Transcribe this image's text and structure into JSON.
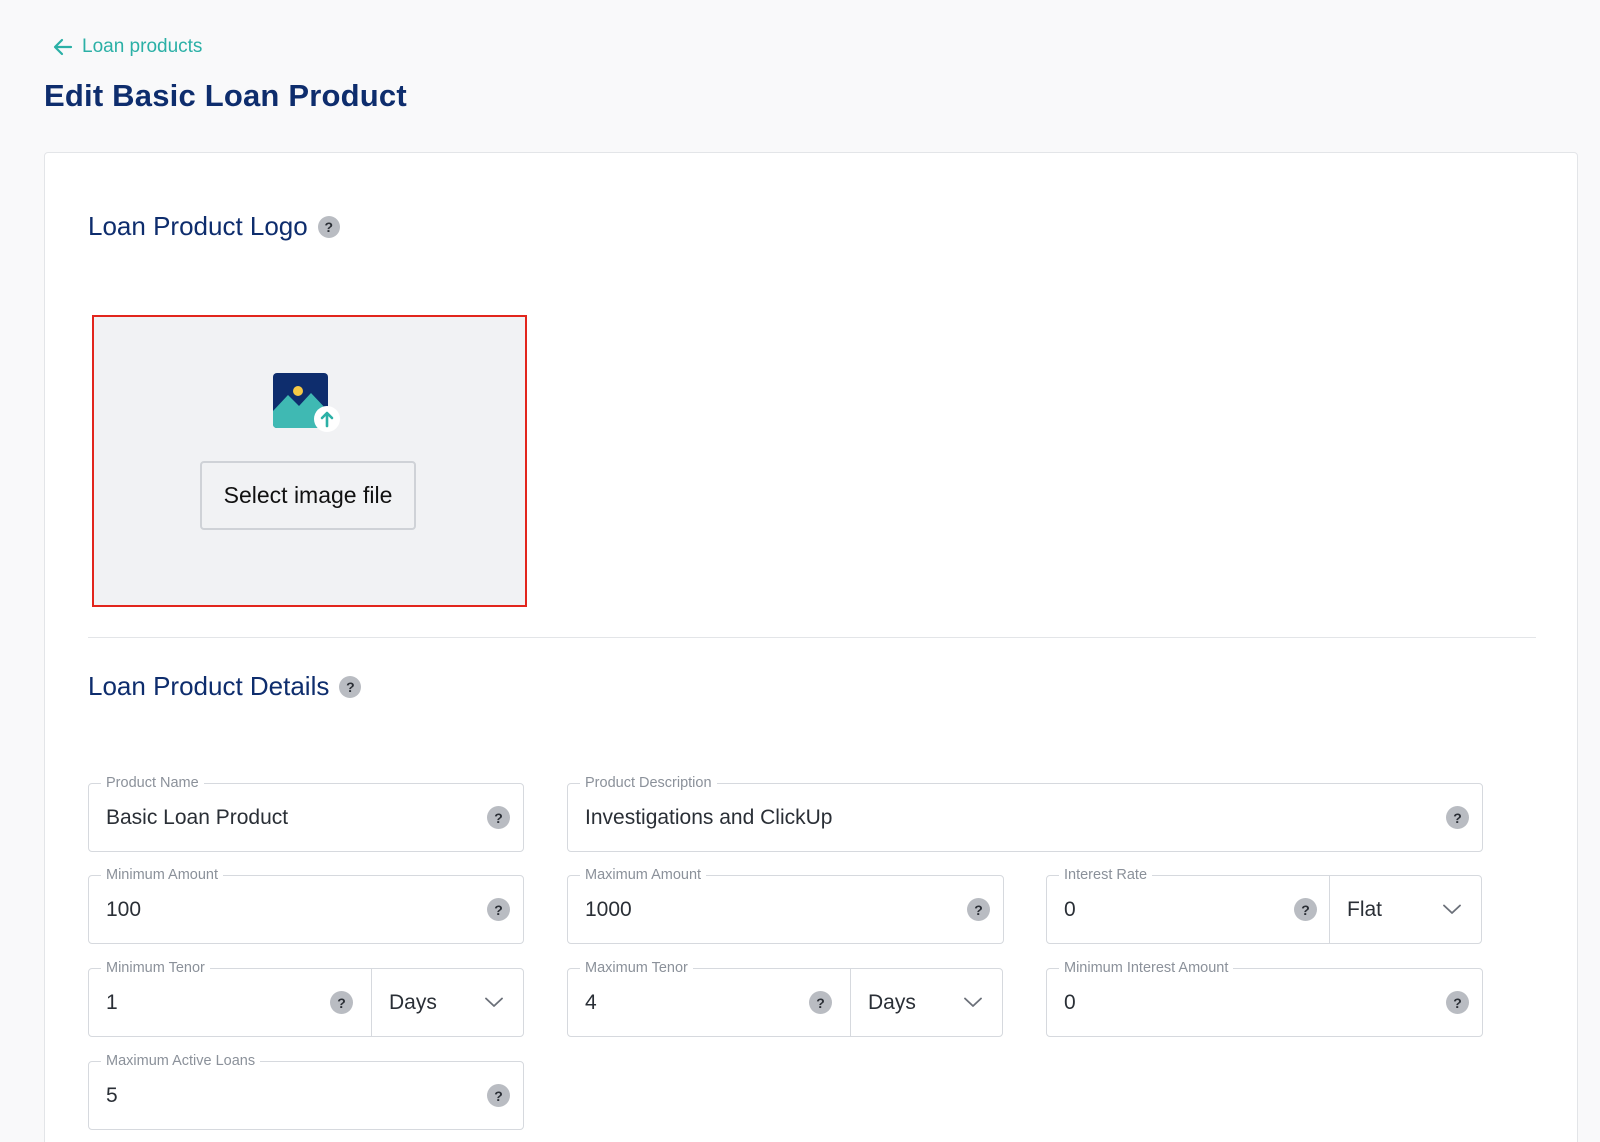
{
  "breadcrumb": {
    "back_label": "Loan products"
  },
  "page": {
    "title": "Edit Basic Loan Product"
  },
  "logo_section": {
    "title": "Loan Product Logo",
    "help": "?",
    "select_button": "Select image file"
  },
  "details_section": {
    "title": "Loan Product Details",
    "help": "?"
  },
  "fields": {
    "product_name": {
      "label": "Product Name",
      "value": "Basic Loan Product"
    },
    "product_description": {
      "label": "Product Description",
      "value": "Investigations and ClickUp"
    },
    "minimum_amount": {
      "label": "Minimum Amount",
      "value": "100"
    },
    "maximum_amount": {
      "label": "Maximum Amount",
      "value": "1000"
    },
    "interest_rate": {
      "label": "Interest Rate",
      "value": "0",
      "type_selected": "Flat"
    },
    "minimum_tenor": {
      "label": "Minimum Tenor",
      "value": "1",
      "unit_selected": "Days"
    },
    "maximum_tenor": {
      "label": "Maximum Tenor",
      "value": "4",
      "unit_selected": "Days"
    },
    "minimum_interest_amount": {
      "label": "Minimum Interest Amount",
      "value": "0"
    },
    "maximum_active_loans": {
      "label": "Maximum Active Loans",
      "value": "5"
    }
  },
  "help_glyph": "?",
  "colors": {
    "accent_teal": "#2bb0a6",
    "title_navy": "#0e2d6d",
    "upload_border": "#e2251c"
  }
}
